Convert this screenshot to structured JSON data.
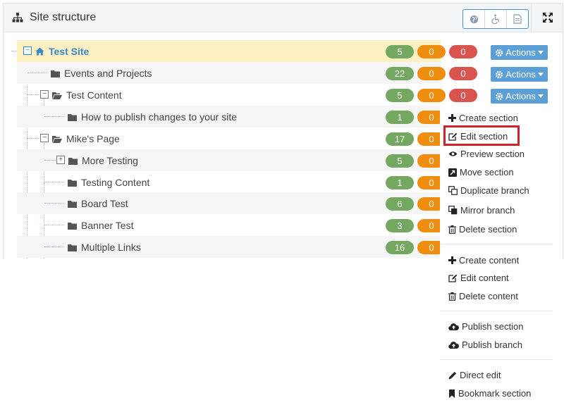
{
  "header": {
    "title": "Site structure",
    "buttons": [
      {
        "icon": "globe-icon"
      },
      {
        "icon": "accessibility-icon"
      },
      {
        "icon": "document-icon"
      }
    ],
    "expand_icon": "expand-icon"
  },
  "tree": [
    {
      "label": "Test Site",
      "icon": "home-icon",
      "toggle": "−",
      "counts": [
        "5",
        "0",
        "0"
      ],
      "actions": "Actions"
    },
    {
      "label": "Events and Projects",
      "icon": "folder-icon",
      "counts": [
        "22",
        "0",
        "0"
      ],
      "actions": "Actions"
    },
    {
      "label": "Test Content",
      "icon": "folder-open-icon",
      "toggle": "−",
      "counts": [
        "5",
        "0",
        "0"
      ],
      "actions": "Actions"
    },
    {
      "label": "How to publish changes to your site",
      "icon": "folder-icon",
      "counts": [
        "1",
        "0"
      ]
    },
    {
      "label": "Mike's Page",
      "icon": "folder-open-icon",
      "toggle": "−",
      "counts": [
        "17",
        "0"
      ]
    },
    {
      "label": "More Testing",
      "icon": "folder-icon",
      "toggle": "+",
      "counts": [
        "5",
        "0"
      ]
    },
    {
      "label": "Testing Content",
      "icon": "folder-icon",
      "counts": [
        "1",
        "0"
      ]
    },
    {
      "label": "Board Test",
      "icon": "folder-icon",
      "counts": [
        "6",
        "0"
      ]
    },
    {
      "label": "Banner Test",
      "icon": "folder-icon",
      "counts": [
        "3",
        "0"
      ]
    },
    {
      "label": "Multiple Links",
      "icon": "folder-icon",
      "counts": [
        "16",
        "0"
      ]
    }
  ],
  "menu": {
    "items": [
      {
        "label": "Create section",
        "icon": "plus-icon"
      },
      {
        "label": "Edit section",
        "icon": "edit-icon"
      },
      {
        "label": "Preview section",
        "icon": "eye-icon"
      },
      {
        "label": "Move section",
        "icon": "move-icon"
      },
      {
        "label": "Duplicate branch",
        "icon": "duplicate-icon"
      },
      {
        "label": "Mirror branch",
        "icon": "mirror-icon"
      },
      {
        "label": "Delete section",
        "icon": "trash-icon"
      },
      {
        "label": "Create content",
        "icon": "plus-icon"
      },
      {
        "label": "Edit content",
        "icon": "edit-icon"
      },
      {
        "label": "Delete content",
        "icon": "trash-icon"
      },
      {
        "label": "Publish section",
        "icon": "cloud-upload-icon"
      },
      {
        "label": "Publish branch",
        "icon": "cloud-upload-icon"
      },
      {
        "label": "Direct edit",
        "icon": "pencil-icon"
      },
      {
        "label": "Bookmark section",
        "icon": "bookmark-icon"
      }
    ]
  },
  "colors": {
    "green": "#74a860",
    "orange": "#f18d0e",
    "red": "#d9534f",
    "accent": "#5b9fd6",
    "highlight": "#d0222a",
    "selected_row": "#fcefc1"
  }
}
